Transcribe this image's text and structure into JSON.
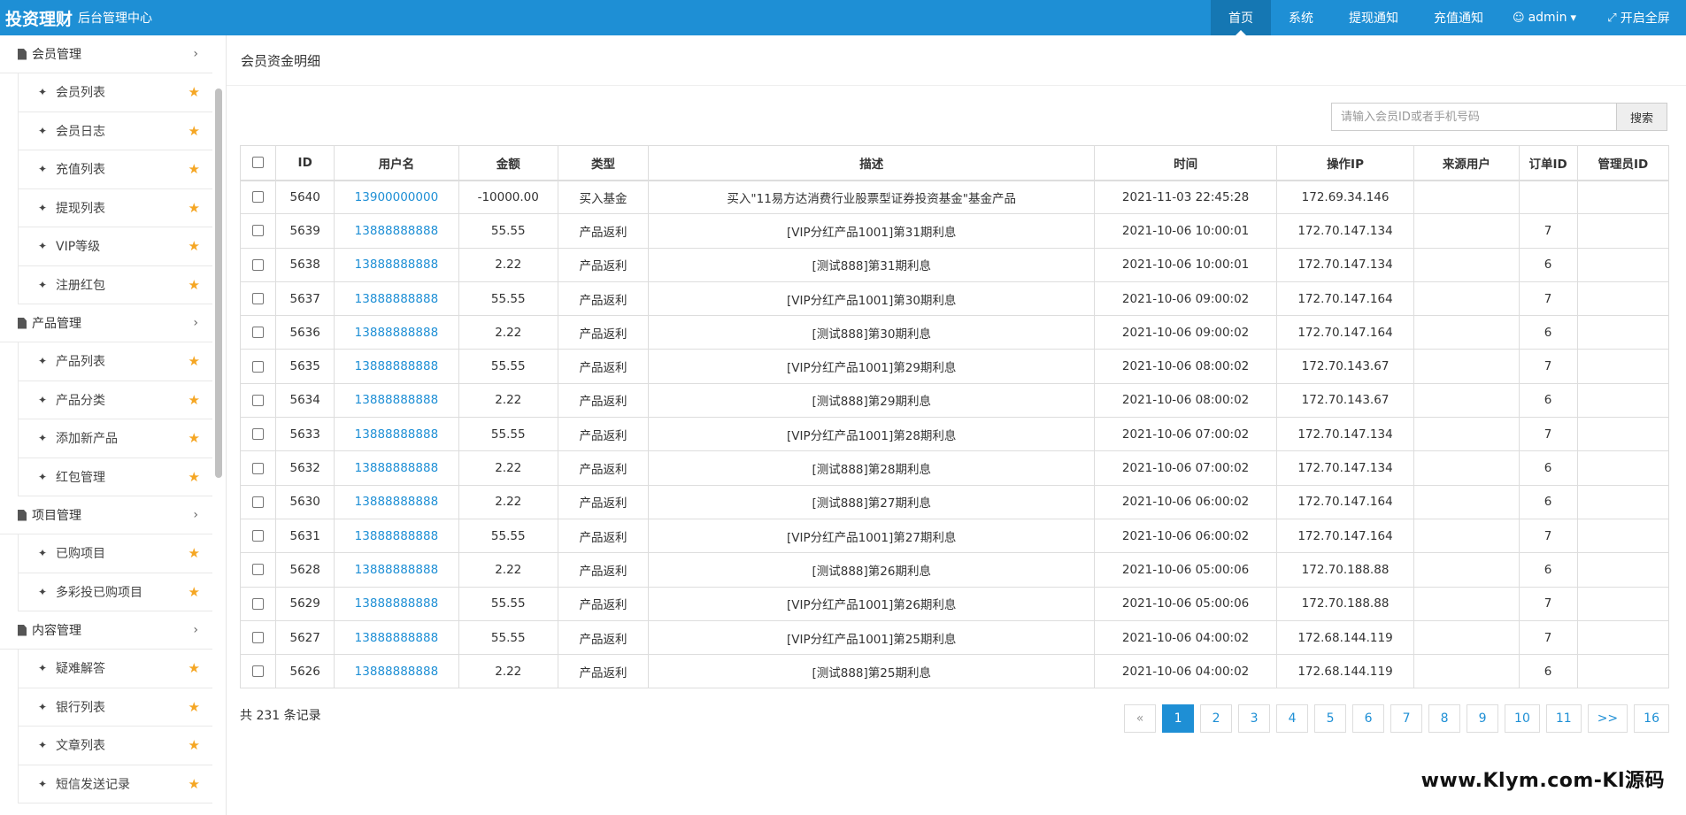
{
  "brand": {
    "name": "投资理财",
    "subtitle": "后台管理中心"
  },
  "topnav": [
    {
      "label": "首页",
      "active": true,
      "icon": ""
    },
    {
      "label": "系统",
      "active": false,
      "icon": ""
    },
    {
      "label": "提现通知",
      "active": false,
      "icon": ""
    },
    {
      "label": "充值通知",
      "active": false,
      "icon": ""
    },
    {
      "label": "admin",
      "active": false,
      "icon": "user-icon"
    },
    {
      "label": "开启全屏",
      "active": false,
      "icon": "expand-icon"
    }
  ],
  "sidebar": {
    "groups": [
      {
        "label": "会员管理",
        "items": [
          "会员列表",
          "会员日志",
          "充值列表",
          "提现列表",
          "VIP等级",
          "注册红包"
        ]
      },
      {
        "label": "产品管理",
        "items": [
          "产品列表",
          "产品分类",
          "添加新产品",
          "红包管理"
        ]
      },
      {
        "label": "项目管理",
        "items": [
          "已购项目",
          "多彩投已购项目"
        ]
      },
      {
        "label": "内容管理",
        "items": [
          "疑难解答",
          "银行列表",
          "文章列表",
          "短信发送记录"
        ]
      }
    ]
  },
  "page_title": "会员资金明细",
  "search": {
    "placeholder": "请输入会员ID或者手机号码",
    "button": "搜索"
  },
  "table": {
    "columns": [
      "ID",
      "用户名",
      "金额",
      "类型",
      "描述",
      "时间",
      "操作IP",
      "来源用户",
      "订单ID",
      "管理员ID"
    ],
    "rows": [
      [
        "5640",
        "13900000000",
        "-10000.00",
        "买入基金",
        "买入\"11易方达消费行业股票型证券投资基金\"基金产品",
        "2021-11-03 22:45:28",
        "172.69.34.146",
        "",
        "",
        ""
      ],
      [
        "5639",
        "13888888888",
        "55.55",
        "产品返利",
        "[VIP分红产品1001]第31期利息",
        "2021-10-06 10:00:01",
        "172.70.147.134",
        "",
        "7",
        ""
      ],
      [
        "5638",
        "13888888888",
        "2.22",
        "产品返利",
        "[测试888]第31期利息",
        "2021-10-06 10:00:01",
        "172.70.147.134",
        "",
        "6",
        ""
      ],
      [
        "5637",
        "13888888888",
        "55.55",
        "产品返利",
        "[VIP分红产品1001]第30期利息",
        "2021-10-06 09:00:02",
        "172.70.147.164",
        "",
        "7",
        ""
      ],
      [
        "5636",
        "13888888888",
        "2.22",
        "产品返利",
        "[测试888]第30期利息",
        "2021-10-06 09:00:02",
        "172.70.147.164",
        "",
        "6",
        ""
      ],
      [
        "5635",
        "13888888888",
        "55.55",
        "产品返利",
        "[VIP分红产品1001]第29期利息",
        "2021-10-06 08:00:02",
        "172.70.143.67",
        "",
        "7",
        ""
      ],
      [
        "5634",
        "13888888888",
        "2.22",
        "产品返利",
        "[测试888]第29期利息",
        "2021-10-06 08:00:02",
        "172.70.143.67",
        "",
        "6",
        ""
      ],
      [
        "5633",
        "13888888888",
        "55.55",
        "产品返利",
        "[VIP分红产品1001]第28期利息",
        "2021-10-06 07:00:02",
        "172.70.147.134",
        "",
        "7",
        ""
      ],
      [
        "5632",
        "13888888888",
        "2.22",
        "产品返利",
        "[测试888]第28期利息",
        "2021-10-06 07:00:02",
        "172.70.147.134",
        "",
        "6",
        ""
      ],
      [
        "5630",
        "13888888888",
        "2.22",
        "产品返利",
        "[测试888]第27期利息",
        "2021-10-06 06:00:02",
        "172.70.147.164",
        "",
        "6",
        ""
      ],
      [
        "5631",
        "13888888888",
        "55.55",
        "产品返利",
        "[VIP分红产品1001]第27期利息",
        "2021-10-06 06:00:02",
        "172.70.147.164",
        "",
        "7",
        ""
      ],
      [
        "5628",
        "13888888888",
        "2.22",
        "产品返利",
        "[测试888]第26期利息",
        "2021-10-06 05:00:06",
        "172.70.188.88",
        "",
        "6",
        ""
      ],
      [
        "5629",
        "13888888888",
        "55.55",
        "产品返利",
        "[VIP分红产品1001]第26期利息",
        "2021-10-06 05:00:06",
        "172.70.188.88",
        "",
        "7",
        ""
      ],
      [
        "5627",
        "13888888888",
        "55.55",
        "产品返利",
        "[VIP分红产品1001]第25期利息",
        "2021-10-06 04:00:02",
        "172.68.144.119",
        "",
        "7",
        ""
      ],
      [
        "5626",
        "13888888888",
        "2.22",
        "产品返利",
        "[测试888]第25期利息",
        "2021-10-06 04:00:02",
        "172.68.144.119",
        "",
        "6",
        ""
      ]
    ]
  },
  "pagination": {
    "total_text": "共 231 条记录",
    "prev": "«",
    "pages": [
      "1",
      "2",
      "3",
      "4",
      "5",
      "6",
      "7",
      "8",
      "9",
      "10",
      "11"
    ],
    "current": "1",
    "next": ">>",
    "last": "16"
  },
  "watermark": "www.Klym.com-Kl源码",
  "colors": {
    "primary": "#1e8fd5",
    "star": "#f5a623"
  }
}
